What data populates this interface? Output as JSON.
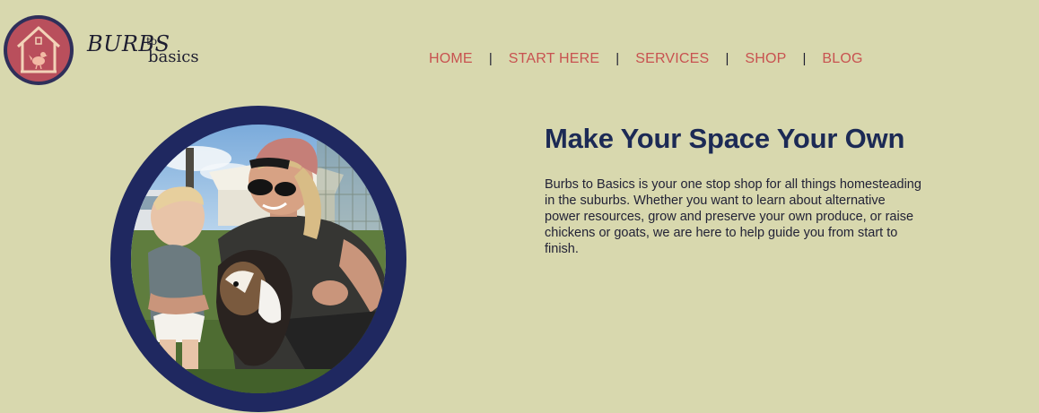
{
  "brand": {
    "word_main": "BURBS",
    "word_to": "to",
    "word_basics": "basics",
    "colors": {
      "ring": "#2f2f5a",
      "badge": "#b94f5c",
      "house": "#f2d3b8",
      "chicken": "#f2b9a4"
    }
  },
  "nav": {
    "items": [
      {
        "label": "HOME"
      },
      {
        "label": "START HERE"
      },
      {
        "label": "SERVICES"
      },
      {
        "label": "SHOP"
      },
      {
        "label": "BLOG"
      }
    ],
    "separator": "|",
    "color": "#c85250"
  },
  "hero": {
    "title": "Make Your Space Your Own",
    "description": "Burbs to Basics is your one stop shop for all things homesteading in the suburbs. Whether you want to learn about alternative power resources, grow and preserve your own produce, or raise chickens or goats, we are here to help guide you from start to finish.",
    "photo_icon": "family-with-goat-photo",
    "frame_color": "#1f2860"
  },
  "page": {
    "background": "#d8d8ae"
  }
}
